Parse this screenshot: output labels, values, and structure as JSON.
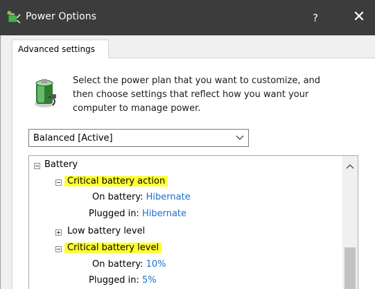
{
  "window": {
    "title": "Power Options",
    "help_label": "?",
    "close_label": "✕"
  },
  "tab": {
    "label": "Advanced settings"
  },
  "description": {
    "lines": [
      "Select the power plan that you want to customize, and",
      "then choose settings that reflect how you want your",
      "computer to manage power."
    ]
  },
  "plan_select": {
    "value": "Balanced [Active]"
  },
  "tree": {
    "battery": {
      "label": "Battery"
    },
    "critical_action": {
      "label": "Critical battery action",
      "on_battery_label": "On battery:",
      "on_battery_value": "Hibernate",
      "plugged_in_label": "Plugged in:",
      "plugged_in_value": "Hibernate"
    },
    "low_level": {
      "label": "Low battery level"
    },
    "critical_level": {
      "label": "Critical battery level",
      "on_battery_label": "On battery:",
      "on_battery_value": "10%",
      "plugged_in_label": "Plugged in:",
      "plugged_in_value": "5%"
    }
  },
  "colors": {
    "titlebar": "#3c3c3c",
    "highlight": "#ffff33",
    "link": "#1a6fd0"
  }
}
